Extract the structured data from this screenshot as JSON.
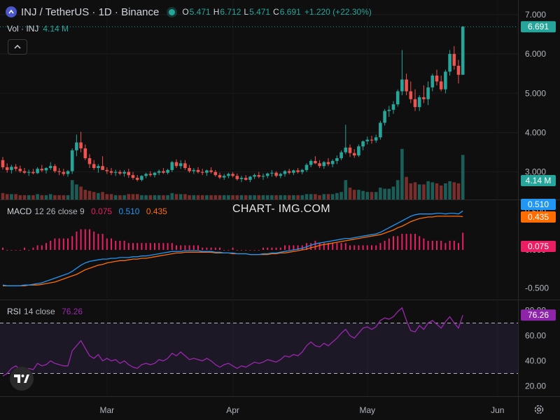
{
  "header": {
    "symbol": "INJ / TetherUS · 1D · Binance",
    "open_label": "O",
    "open": "5.471",
    "high_label": "H",
    "high": "6.712",
    "low_label": "L",
    "low": "5.471",
    "close_label": "C",
    "close": "6.691",
    "change": "+1.220 (+22.30%)"
  },
  "volume": {
    "label": "Vol · INJ",
    "value": "4.14 M"
  },
  "macd": {
    "label": "MACD",
    "params": "12 26 close 9",
    "hist": "0.075",
    "macd": "0.510",
    "signal": "0.435"
  },
  "rsi": {
    "label": "RSI",
    "params": "14 close",
    "value": "76.26"
  },
  "watermark": "CHART- IMG.COM",
  "colors": {
    "up": "#26a69a",
    "down": "#ef5350",
    "macd": "#2196f3",
    "signal": "#ff6d00",
    "hist": "#e91e63",
    "rsi": "#9c27b0"
  },
  "chart_data": [
    {
      "type": "candlestick",
      "title": "INJ / TetherUS · 1D · Binance",
      "y_ticks": [
        "7.000",
        "6.000",
        "5.000",
        "4.000",
        "3.000"
      ],
      "ylim": [
        2.3,
        7.3
      ],
      "last_price": "6.691",
      "x_ticks": [
        "Mar",
        "Apr",
        "May",
        "Jun"
      ],
      "ohlc": [
        [
          3.3,
          3.38,
          3.06,
          3.12
        ],
        [
          3.12,
          3.22,
          2.98,
          3.05
        ],
        [
          3.05,
          3.18,
          2.96,
          3.13
        ],
        [
          3.13,
          3.2,
          3.02,
          3.08
        ],
        [
          3.08,
          3.16,
          2.98,
          3.02
        ],
        [
          3.02,
          3.1,
          2.95,
          2.98
        ],
        [
          2.98,
          3.06,
          2.9,
          3.0
        ],
        [
          3.0,
          3.08,
          2.94,
          2.97
        ],
        [
          2.97,
          3.12,
          2.95,
          3.08
        ],
        [
          3.08,
          3.18,
          3.0,
          3.04
        ],
        [
          3.04,
          3.12,
          2.96,
          3.1
        ],
        [
          3.1,
          3.25,
          3.05,
          3.15
        ],
        [
          3.15,
          3.2,
          2.98,
          3.02
        ],
        [
          3.02,
          3.1,
          2.92,
          3.0
        ],
        [
          3.0,
          3.08,
          2.9,
          2.95
        ],
        [
          2.95,
          3.05,
          2.88,
          3.02
        ],
        [
          3.02,
          3.6,
          2.95,
          3.55
        ],
        [
          3.55,
          3.95,
          3.4,
          3.75
        ],
        [
          3.75,
          4.02,
          3.5,
          3.6
        ],
        [
          3.6,
          3.7,
          3.3,
          3.35
        ],
        [
          3.35,
          3.45,
          3.1,
          3.2
        ],
        [
          3.2,
          3.3,
          3.05,
          3.1
        ],
        [
          3.1,
          3.2,
          2.98,
          3.15
        ],
        [
          3.15,
          3.4,
          3.08,
          3.05
        ],
        [
          3.05,
          3.12,
          2.95,
          3.02
        ],
        [
          3.02,
          3.1,
          2.92,
          2.98
        ],
        [
          2.98,
          3.06,
          2.9,
          3.0
        ],
        [
          3.0,
          3.05,
          2.92,
          2.96
        ],
        [
          2.96,
          3.05,
          2.88,
          3.0
        ],
        [
          3.0,
          3.08,
          2.85,
          2.92
        ],
        [
          2.92,
          3.0,
          2.8,
          2.85
        ],
        [
          2.85,
          2.92,
          2.76,
          2.8
        ],
        [
          2.8,
          2.92,
          2.76,
          2.9
        ],
        [
          2.9,
          2.98,
          2.84,
          2.95
        ],
        [
          2.95,
          3.02,
          2.88,
          2.92
        ],
        [
          2.92,
          3.0,
          2.86,
          2.98
        ],
        [
          2.98,
          3.06,
          2.92,
          3.02
        ],
        [
          3.02,
          3.1,
          2.95,
          2.98
        ],
        [
          2.98,
          3.08,
          2.94,
          3.05
        ],
        [
          3.05,
          3.28,
          3.0,
          3.25
        ],
        [
          3.25,
          3.32,
          3.1,
          3.15
        ],
        [
          3.15,
          3.3,
          3.08,
          3.22
        ],
        [
          3.22,
          3.3,
          3.05,
          3.1
        ],
        [
          3.1,
          3.18,
          2.98,
          3.02
        ],
        [
          3.02,
          3.1,
          2.95,
          3.05
        ],
        [
          3.05,
          3.12,
          2.96,
          3.0
        ],
        [
          3.0,
          3.08,
          2.92,
          2.98
        ],
        [
          2.98,
          3.06,
          2.9,
          3.04
        ],
        [
          3.04,
          3.12,
          2.96,
          3.0
        ],
        [
          3.0,
          3.05,
          2.88,
          2.92
        ],
        [
          2.92,
          2.98,
          2.82,
          2.86
        ],
        [
          2.86,
          2.95,
          2.8,
          2.9
        ],
        [
          2.9,
          2.98,
          2.84,
          2.95
        ],
        [
          2.95,
          3.0,
          2.86,
          2.9
        ],
        [
          2.9,
          2.96,
          2.78,
          2.82
        ],
        [
          2.82,
          2.9,
          2.74,
          2.85
        ],
        [
          2.85,
          2.92,
          2.78,
          2.8
        ],
        [
          2.8,
          2.9,
          2.74,
          2.88
        ],
        [
          2.88,
          2.96,
          2.82,
          2.92
        ],
        [
          2.92,
          3.0,
          2.84,
          2.88
        ],
        [
          2.88,
          2.96,
          2.8,
          2.9
        ],
        [
          2.9,
          2.98,
          2.84,
          2.96
        ],
        [
          2.96,
          3.05,
          2.88,
          2.98
        ],
        [
          2.98,
          3.02,
          2.86,
          2.9
        ],
        [
          2.9,
          2.98,
          2.84,
          2.95
        ],
        [
          2.95,
          3.05,
          2.88,
          3.02
        ],
        [
          3.02,
          3.08,
          2.94,
          2.98
        ],
        [
          2.98,
          3.06,
          2.92,
          3.04
        ],
        [
          3.04,
          3.1,
          2.96,
          3.0
        ],
        [
          3.0,
          3.08,
          2.94,
          3.05
        ],
        [
          3.05,
          3.22,
          3.0,
          3.18
        ],
        [
          3.18,
          3.32,
          3.12,
          3.28
        ],
        [
          3.28,
          3.4,
          3.2,
          3.22
        ],
        [
          3.22,
          3.3,
          3.1,
          3.15
        ],
        [
          3.15,
          3.28,
          3.08,
          3.25
        ],
        [
          3.25,
          3.35,
          3.15,
          3.2
        ],
        [
          3.2,
          3.32,
          3.12,
          3.28
        ],
        [
          3.28,
          3.42,
          3.2,
          3.35
        ],
        [
          3.35,
          3.55,
          3.3,
          3.5
        ],
        [
          3.5,
          4.2,
          3.45,
          3.62
        ],
        [
          3.62,
          3.7,
          3.38,
          3.48
        ],
        [
          3.48,
          3.58,
          3.36,
          3.42
        ],
        [
          3.42,
          3.7,
          3.38,
          3.65
        ],
        [
          3.65,
          3.8,
          3.55,
          3.78
        ],
        [
          3.78,
          3.9,
          3.7,
          3.82
        ],
        [
          3.82,
          3.92,
          3.72,
          3.8
        ],
        [
          3.8,
          3.95,
          3.74,
          3.88
        ],
        [
          3.88,
          4.3,
          3.82,
          4.25
        ],
        [
          4.25,
          4.6,
          4.18,
          4.55
        ],
        [
          4.55,
          4.68,
          4.4,
          4.58
        ],
        [
          4.58,
          4.8,
          4.48,
          4.72
        ],
        [
          4.72,
          5.1,
          4.66,
          5.05
        ],
        [
          5.05,
          6.1,
          4.95,
          5.35
        ],
        [
          5.35,
          5.5,
          4.95,
          5.05
        ],
        [
          5.05,
          5.3,
          4.75,
          4.85
        ],
        [
          4.85,
          5.1,
          4.55,
          4.65
        ],
        [
          4.65,
          4.95,
          4.55,
          4.9
        ],
        [
          4.9,
          5.2,
          4.75,
          4.85
        ],
        [
          4.85,
          5.3,
          4.7,
          5.15
        ],
        [
          5.15,
          5.5,
          5.05,
          5.45
        ],
        [
          5.45,
          5.6,
          5.2,
          5.3
        ],
        [
          5.3,
          5.45,
          5.05,
          5.1
        ],
        [
          5.1,
          5.6,
          5.0,
          5.55
        ],
        [
          5.55,
          6.1,
          5.45,
          6.0
        ],
        [
          6.0,
          6.2,
          5.6,
          5.7
        ],
        [
          5.7,
          5.85,
          5.25,
          5.47
        ],
        [
          5.471,
          6.712,
          5.471,
          6.691
        ]
      ],
      "volumes_m": [
        0.6,
        0.5,
        0.5,
        0.5,
        0.4,
        0.4,
        0.4,
        0.4,
        0.5,
        0.4,
        0.4,
        0.5,
        0.4,
        0.4,
        0.4,
        0.4,
        1.8,
        1.4,
        1.2,
        0.9,
        0.8,
        0.7,
        0.6,
        0.7,
        0.5,
        0.5,
        0.4,
        0.4,
        0.4,
        0.5,
        0.5,
        0.5,
        0.4,
        0.4,
        0.4,
        0.4,
        0.4,
        0.4,
        0.4,
        0.6,
        0.5,
        0.5,
        0.5,
        0.4,
        0.4,
        0.4,
        0.4,
        0.4,
        0.4,
        0.4,
        0.4,
        0.4,
        0.4,
        0.4,
        0.4,
        0.4,
        0.4,
        0.4,
        0.4,
        0.4,
        0.4,
        0.4,
        0.4,
        0.4,
        0.4,
        0.4,
        0.4,
        0.4,
        0.4,
        0.4,
        0.5,
        0.5,
        0.5,
        0.4,
        0.5,
        0.5,
        0.5,
        0.6,
        0.7,
        1.8,
        1.1,
        0.9,
        0.9,
        0.8,
        0.7,
        0.7,
        0.7,
        1.1,
        1.0,
        1.0,
        1.2,
        1.8,
        4.7,
        2.1,
        1.5,
        1.6,
        1.4,
        1.4,
        1.7,
        1.6,
        1.5,
        1.3,
        1.5,
        1.7,
        1.6,
        1.5,
        4.14
      ]
    },
    {
      "type": "line",
      "title": "MACD 12 26 close 9",
      "y_ticks": [
        "0.500",
        "0.000",
        "-0.500"
      ],
      "ylim": [
        -0.65,
        0.65
      ],
      "series": [
        {
          "name": "macd",
          "values": [
            -0.46,
            -0.47,
            -0.47,
            -0.47,
            -0.47,
            -0.46,
            -0.46,
            -0.45,
            -0.44,
            -0.43,
            -0.41,
            -0.39,
            -0.37,
            -0.35,
            -0.33,
            -0.31,
            -0.28,
            -0.24,
            -0.2,
            -0.17,
            -0.15,
            -0.14,
            -0.13,
            -0.12,
            -0.12,
            -0.11,
            -0.11,
            -0.1,
            -0.1,
            -0.1,
            -0.09,
            -0.09,
            -0.08,
            -0.08,
            -0.07,
            -0.06,
            -0.05,
            -0.04,
            -0.03,
            -0.02,
            -0.02,
            -0.02,
            -0.01,
            -0.01,
            -0.01,
            -0.01,
            -0.02,
            -0.02,
            -0.02,
            -0.03,
            -0.03,
            -0.04,
            -0.04,
            -0.04,
            -0.05,
            -0.05,
            -0.05,
            -0.06,
            -0.06,
            -0.06,
            -0.05,
            -0.05,
            -0.04,
            -0.04,
            -0.03,
            -0.02,
            -0.01,
            0.0,
            0.01,
            0.02,
            0.04,
            0.06,
            0.08,
            0.09,
            0.1,
            0.11,
            0.12,
            0.13,
            0.14,
            0.15,
            0.15,
            0.16,
            0.17,
            0.18,
            0.19,
            0.2,
            0.21,
            0.23,
            0.26,
            0.29,
            0.32,
            0.35,
            0.38,
            0.41,
            0.44,
            0.46,
            0.47,
            0.47,
            0.47,
            0.47,
            0.48,
            0.48,
            0.47,
            0.48,
            0.48,
            0.47,
            0.51
          ]
        },
        {
          "name": "signal",
          "values": [
            -0.47,
            -0.47,
            -0.47,
            -0.47,
            -0.47,
            -0.47,
            -0.46,
            -0.46,
            -0.46,
            -0.45,
            -0.44,
            -0.43,
            -0.42,
            -0.4,
            -0.38,
            -0.36,
            -0.34,
            -0.32,
            -0.29,
            -0.26,
            -0.24,
            -0.22,
            -0.2,
            -0.19,
            -0.17,
            -0.16,
            -0.15,
            -0.14,
            -0.14,
            -0.13,
            -0.12,
            -0.12,
            -0.11,
            -0.11,
            -0.1,
            -0.09,
            -0.08,
            -0.07,
            -0.06,
            -0.05,
            -0.04,
            -0.04,
            -0.03,
            -0.03,
            -0.03,
            -0.03,
            -0.03,
            -0.03,
            -0.03,
            -0.04,
            -0.04,
            -0.04,
            -0.04,
            -0.05,
            -0.05,
            -0.05,
            -0.05,
            -0.06,
            -0.06,
            -0.06,
            -0.06,
            -0.06,
            -0.05,
            -0.05,
            -0.04,
            -0.04,
            -0.03,
            -0.02,
            -0.01,
            0.0,
            0.01,
            0.03,
            0.04,
            0.06,
            0.07,
            0.08,
            0.09,
            0.1,
            0.11,
            0.12,
            0.13,
            0.14,
            0.15,
            0.16,
            0.17,
            0.18,
            0.19,
            0.2,
            0.22,
            0.24,
            0.26,
            0.29,
            0.31,
            0.34,
            0.37,
            0.39,
            0.41,
            0.42,
            0.43,
            0.43,
            0.44,
            0.44,
            0.44,
            0.44,
            0.44,
            0.44,
            0.435
          ]
        }
      ]
    },
    {
      "type": "line",
      "title": "RSI 14 close",
      "y_ticks": [
        "80.00",
        "60.00",
        "40.00",
        "20.00"
      ],
      "ylim": [
        12,
        88
      ],
      "bands": [
        30,
        70
      ],
      "series": [
        {
          "name": "RSI",
          "values": [
            28,
            30,
            34,
            36,
            33,
            32,
            34,
            33,
            38,
            36,
            37,
            40,
            38,
            37,
            36,
            36,
            48,
            52,
            56,
            50,
            44,
            42,
            45,
            40,
            42,
            40,
            41,
            38,
            40,
            37,
            35,
            34,
            37,
            38,
            37,
            38,
            41,
            40,
            42,
            46,
            44,
            47,
            44,
            41,
            42,
            41,
            40,
            42,
            40,
            37,
            35,
            37,
            38,
            36,
            34,
            36,
            35,
            37,
            39,
            38,
            39,
            41,
            40,
            39,
            41,
            44,
            43,
            45,
            44,
            47,
            52,
            55,
            52,
            51,
            54,
            52,
            55,
            58,
            62,
            65,
            60,
            58,
            62,
            66,
            67,
            65,
            67,
            72,
            74,
            73,
            75,
            79,
            82,
            72,
            64,
            63,
            68,
            65,
            70,
            72,
            69,
            66,
            71,
            75,
            70,
            66,
            76.26
          ]
        }
      ]
    }
  ]
}
